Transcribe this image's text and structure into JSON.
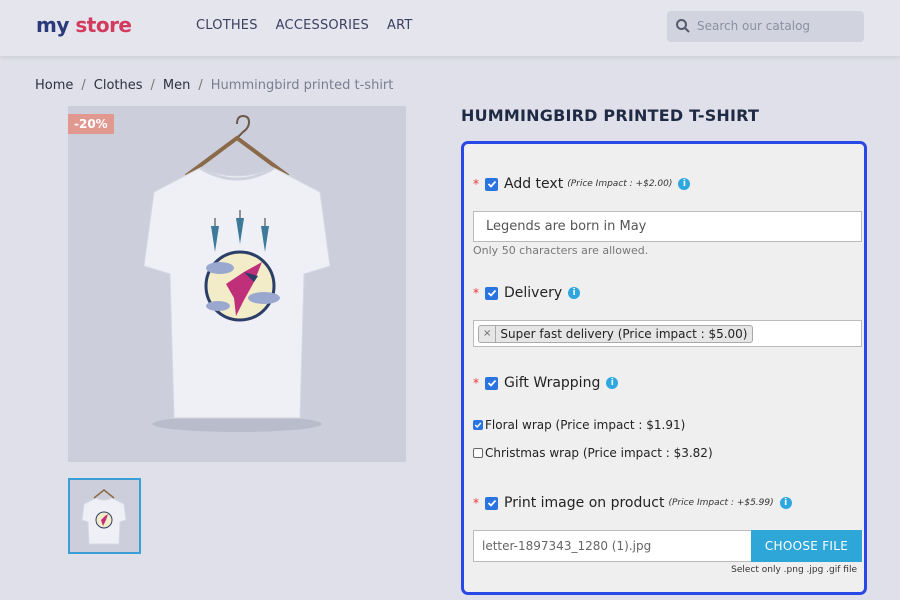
{
  "header": {
    "logo_part1": "my",
    "logo_part2": "store",
    "nav": [
      "CLOTHES",
      "ACCESSORIES",
      "ART"
    ],
    "search_placeholder": "Search our catalog"
  },
  "breadcrumb": {
    "items": [
      "Home",
      "Clothes",
      "Men"
    ],
    "current": "Hummingbird printed t-shirt"
  },
  "product": {
    "title": "HUMMINGBIRD PRINTED T-SHIRT",
    "discount": "-20%"
  },
  "customization": {
    "add_text": {
      "label": "Add text",
      "impact": "(Price Impact : +$2.00)",
      "value": "Legends are born in May",
      "hint": "Only 50 characters are allowed."
    },
    "delivery": {
      "label": "Delivery",
      "selected": "Super fast delivery (Price impact : $5.00)",
      "remove": "×"
    },
    "gift_wrapping": {
      "label": "Gift Wrapping",
      "options": [
        {
          "label": "Floral wrap (Price impact : $1.91)",
          "checked": true
        },
        {
          "label": "Christmas wrap (Price impact : $3.82)",
          "checked": false
        }
      ]
    },
    "print_image": {
      "label": "Print image on product",
      "impact": "(Price Impact : +$5.99)",
      "file_name": "letter-1897343_1280 (1).jpg",
      "button": "CHOOSE FILE",
      "hint": "Select only .png .jpg .gif file"
    },
    "required_mark": "*",
    "info_glyph": "i"
  },
  "colors": {
    "accent": "#2848e8",
    "button": "#2ea7d8",
    "checkbox": "#2a74e0",
    "required": "#ee3333"
  }
}
